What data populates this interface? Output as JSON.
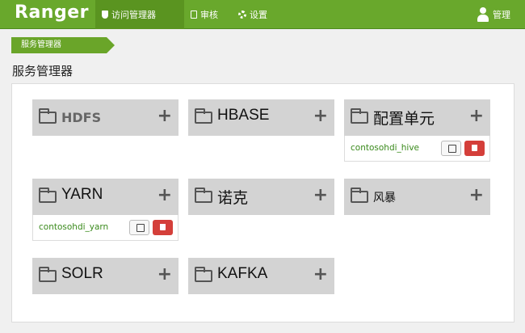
{
  "topbar": {
    "brand": "Ranger",
    "nav": {
      "access_manager": "访问管理器",
      "audit": "审核",
      "settings": "设置"
    },
    "user": "管理"
  },
  "breadcrumb": "服务管理器",
  "page_title": "服务管理器",
  "services": [
    {
      "name": "HDFS",
      "repo": ""
    },
    {
      "name": "HBASE",
      "repo": ""
    },
    {
      "name": "配置单元",
      "repo": "contosohdi_hive"
    },
    {
      "name": "YARN",
      "repo": "contosohdi_yarn"
    },
    {
      "name": "诺克",
      "repo": ""
    },
    {
      "name": "风暴",
      "repo": ""
    },
    {
      "name": "SOLR",
      "repo": ""
    },
    {
      "name": "KAFKA",
      "repo": ""
    }
  ],
  "add_symbol": "+",
  "colors": {
    "nav": "#69a82c",
    "link": "#3a8a1c",
    "delete": "#d43f3a"
  }
}
